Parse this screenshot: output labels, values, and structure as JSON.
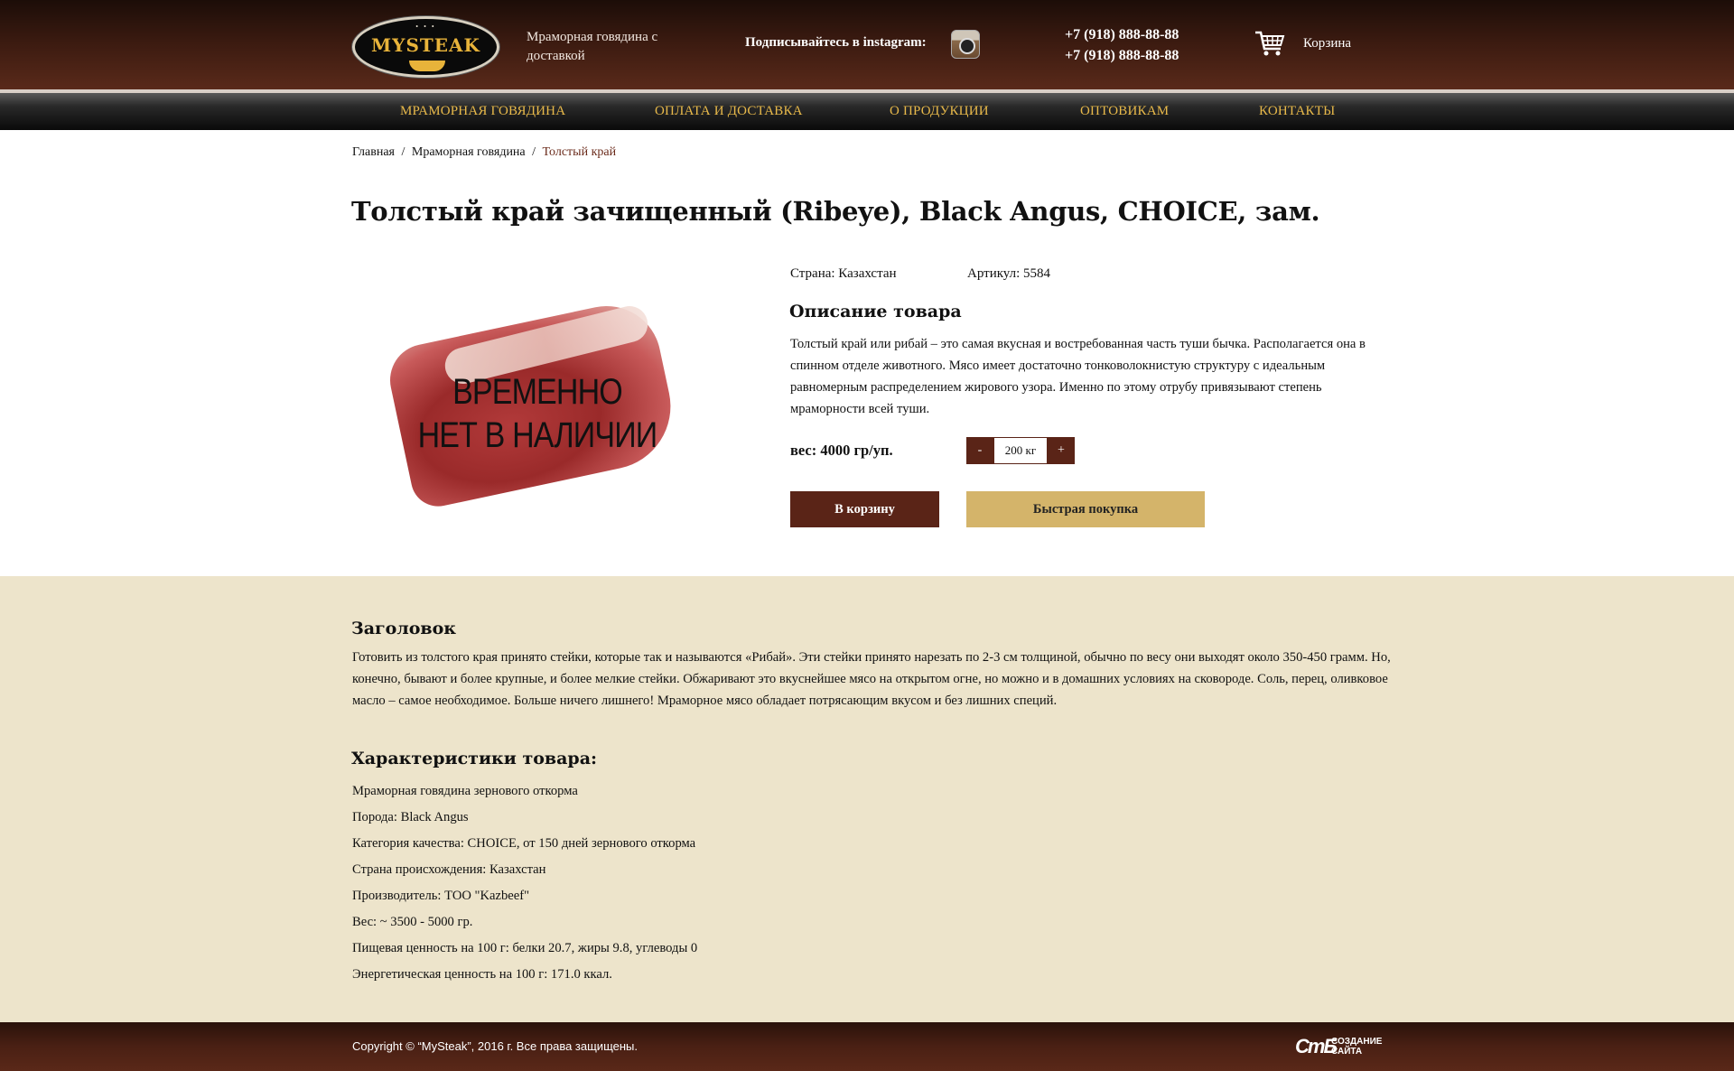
{
  "header": {
    "logo_text": "MYSTEAK",
    "logo_dots": "• • •",
    "tagline": "Мраморная говядина с доставкой",
    "instagram_label": "Подписывайтесь в instagram:",
    "phone_1": "+7 (918) 888-88-88",
    "phone_2": "+7 (918) 888-88-88",
    "cart_label": "Корзина",
    "cart_icon": "shopping-cart-icon",
    "instagram_icon": "instagram-camera-icon"
  },
  "nav": {
    "items": [
      {
        "label": "МРАМОРНАЯ ГОВЯДИНА"
      },
      {
        "label": "ОПЛАТА И ДОСТАВКА"
      },
      {
        "label": "О ПРОДУКЦИИ"
      },
      {
        "label": "ОПТОВИКАМ"
      },
      {
        "label": "КОНТАКТЫ"
      }
    ]
  },
  "breadcrumb": {
    "items": [
      "Главная",
      "Мраморная говядина",
      "Толстый край"
    ],
    "separator": "/"
  },
  "product": {
    "title": "Толстый край зачищенный (Ribeye), Black Angus, CHOICE, зам.",
    "image_overlay_line1": "ВРЕМЕННО",
    "image_overlay_line2": "НЕТ В НАЛИЧИИ",
    "country": "Страна: Казахстан",
    "sku": "Артикул: 5584",
    "description_title": "Описание товара",
    "description": "Толстый край или рибай – это самая вкусная и востребованная часть туши бычка. Располагается она в спинном отделе животного. Мясо имеет достаточно тонковолокнистую структуру с идеальным равномерным распределением жирового узора. Именно по этому отрубу привязывают степень мраморности всей туши.",
    "weight": "вес: 4000 гр/уп.",
    "qty_minus": "-",
    "qty_value": "200 кг",
    "qty_plus": "+",
    "add_to_cart": "В корзину",
    "quick_buy": "Быстрая покупка"
  },
  "info": {
    "heading": "Заголовок",
    "text": "Готовить из толстого края принято стейки, которые так и называются «Рибай». Эти стейки принято нарезать по 2-3 см толщиной, обычно по весу они выходят около 350-450 грамм. Но, конечно, бывают и более крупные, и более мелкие стейки. Обжаривают это вкуснейшее мясо на открытом огне, но можно и в домашних условиях на сковороде. Соль, перец, оливковое масло – самое необходимое. Больше ничего лишнего! Мраморное мясо обладает потрясающим вкусом и без лишних специй.",
    "characteristics_heading": "Характеристики товара:",
    "characteristics": [
      "Мраморная говядина зернового откорма",
      "Порода: Black Angus",
      "Категория качества: CHOICE, от 150 дней зернового откорма",
      "Страна происхождения: Казахстан",
      "Производитель: ТОО \"Kazbeef\"",
      "Вес: ~ 3500 - 5000 гр.",
      "Пищевая ценность на 100 г: белки 20.7, жиры 9.8, углеводы 0",
      "Энергетическая ценность на 100 г:  171.0 ккал."
    ]
  },
  "footer": {
    "copyright": "Copyright © “MySteak”, 2016 г.  Все права защищены.",
    "dev_mark": "СтБ",
    "dev_text": "СОЗДАНИЕ САЙТА"
  },
  "colors": {
    "brand_brown": "#5a2417",
    "nav_gold": "#e8b94a",
    "quick_buy_gold": "#d4b46a",
    "info_bg": "#ede4cb"
  }
}
